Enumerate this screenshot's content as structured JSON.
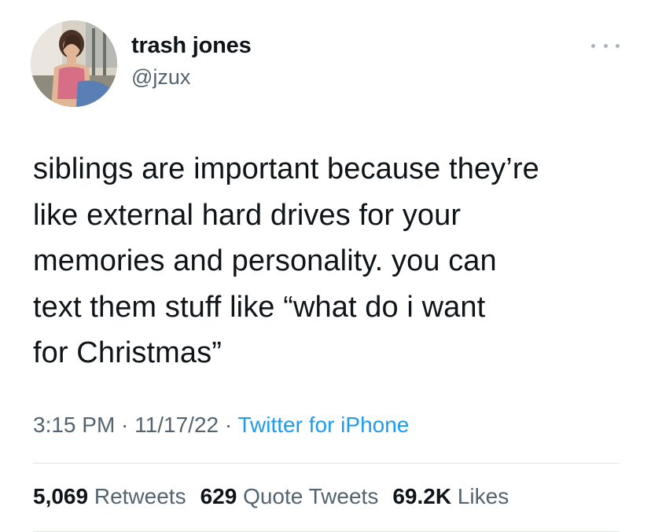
{
  "author": {
    "display_name": "trash jones",
    "handle": "@jzux",
    "avatar_icon": "profile-photo"
  },
  "more_icon": "ellipsis-icon",
  "tweet": {
    "text": "siblings are important because they’re\nlike external hard drives for your\nmemories and personality. you can\ntext them stuff like “what do i want\nfor Christmas”"
  },
  "meta": {
    "time": "3:15 PM",
    "separator": " · ",
    "date": "11/17/22",
    "source": "Twitter for iPhone"
  },
  "stats": {
    "retweets_count": "5,069",
    "retweets_label": "Retweets",
    "quotes_count": "629",
    "quotes_label": "Quote Tweets",
    "likes_count": "69.2K",
    "likes_label": "Likes"
  },
  "colors": {
    "text": "#0f1419",
    "secondary": "#536471",
    "link": "#1d9bf0",
    "divider": "#e3e6e9"
  }
}
